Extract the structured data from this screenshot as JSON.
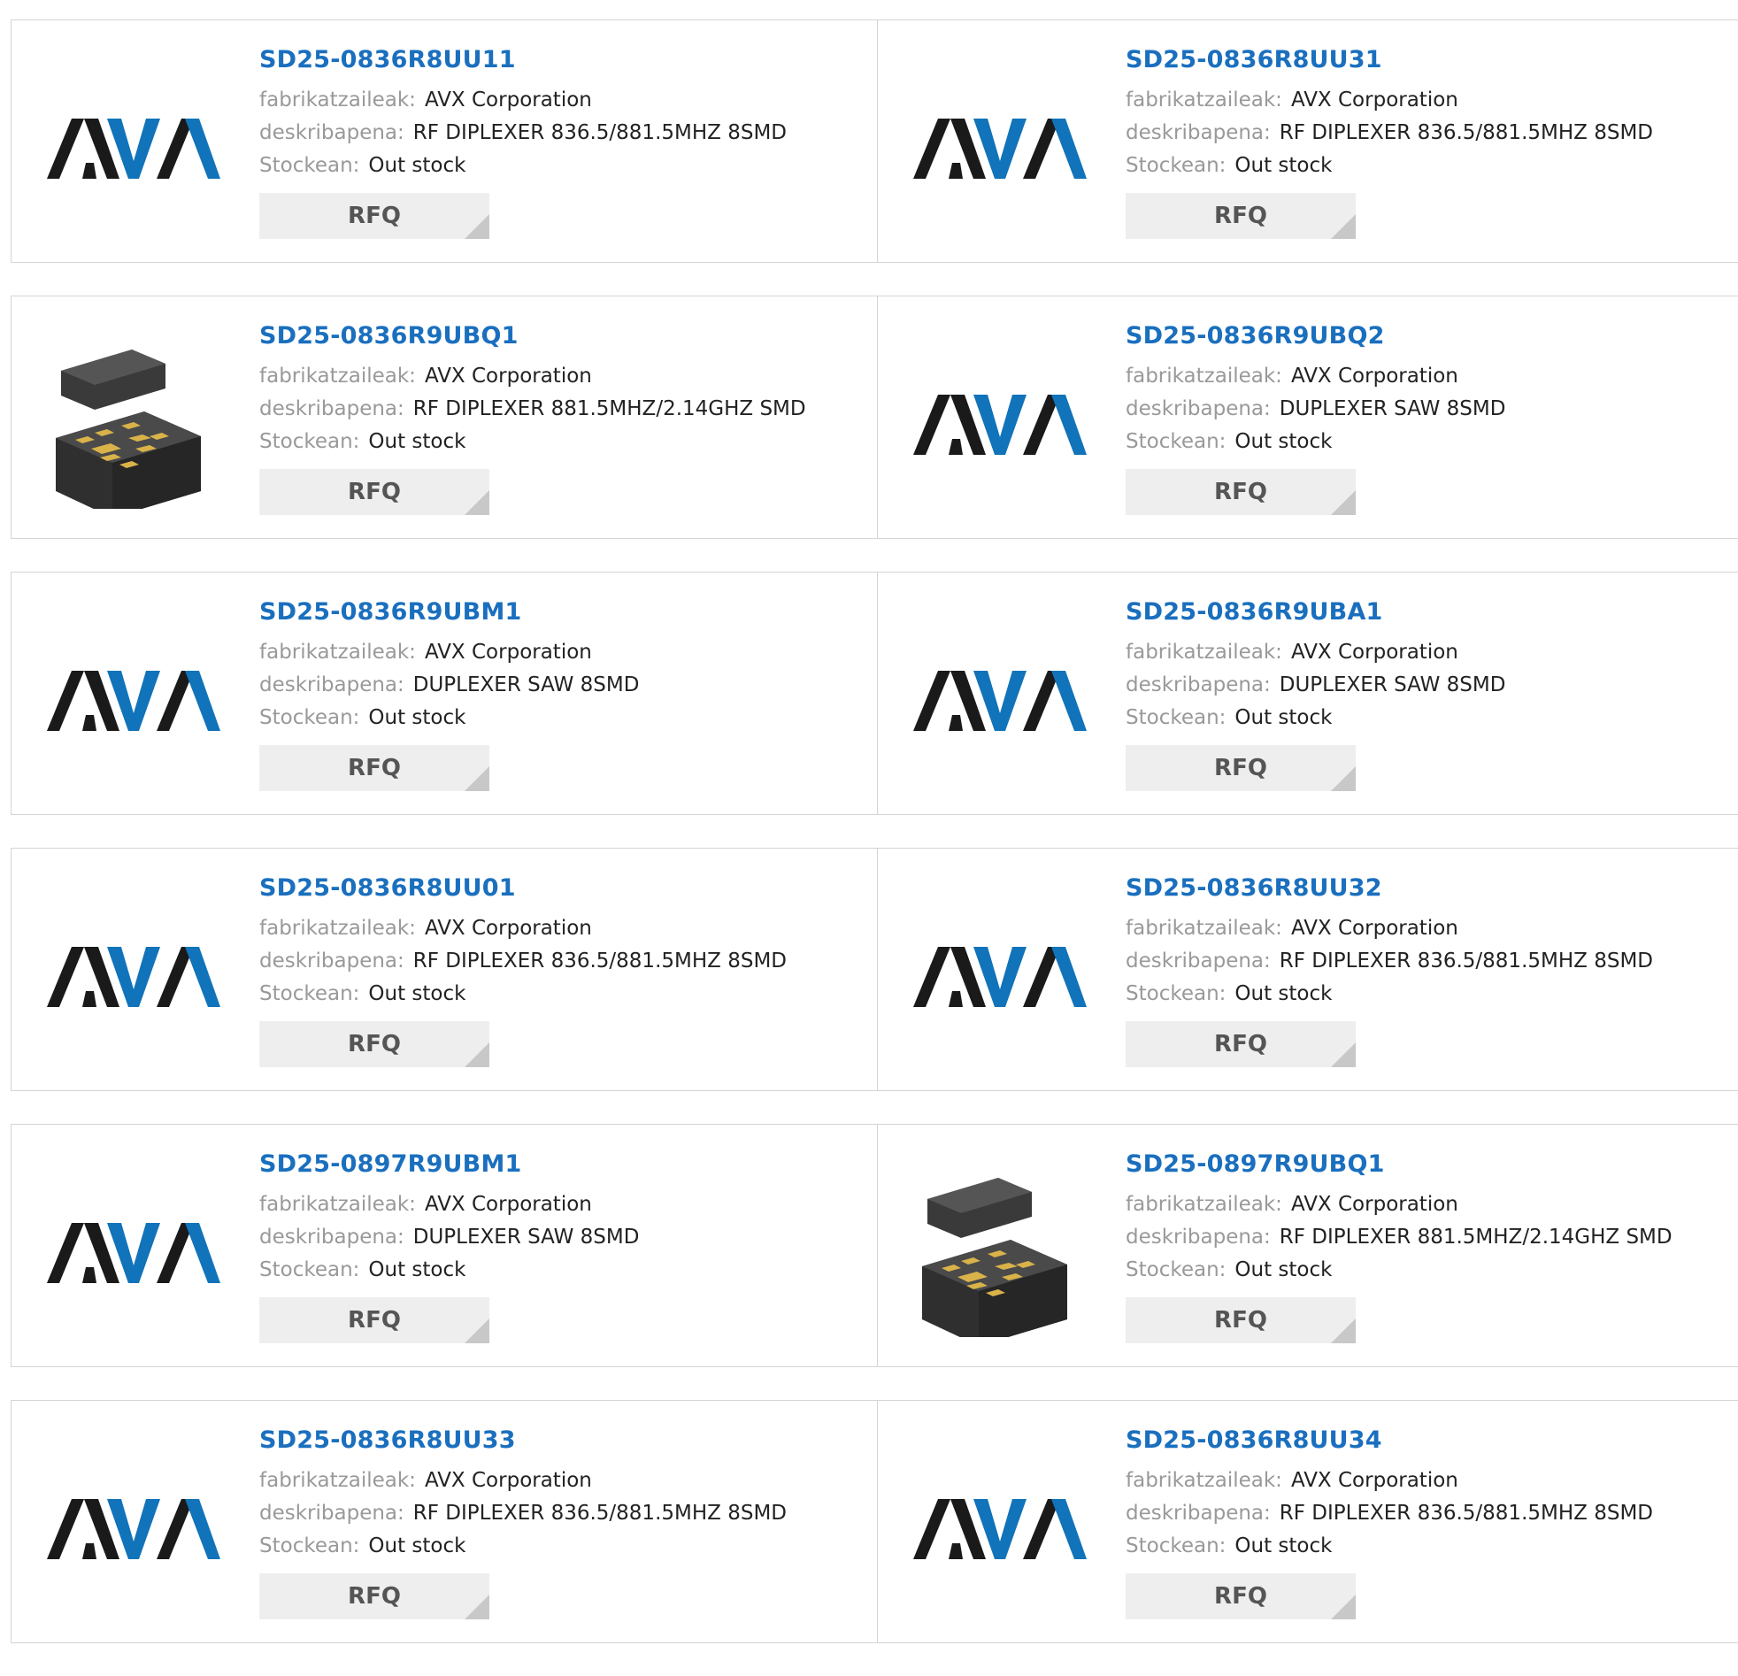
{
  "brand_colors": {
    "title": "#1a6fbe",
    "logo_black": "#1a1a1a",
    "logo_blue": "#1173b9"
  },
  "labels": {
    "manufacturer": "fabrikatzaileak:",
    "description": "deskribapena:",
    "stock": "Stockean:",
    "rfq": "RFQ"
  },
  "products": [
    {
      "part": "SD25-0836R8UU11",
      "manufacturer": "AVX Corporation",
      "description": "RF DIPLEXER 836.5/881.5MHZ 8SMD",
      "stock": "Out stock",
      "image": "avx-logo",
      "logo_text": "AVX"
    },
    {
      "part": "SD25-0836R8UU31",
      "manufacturer": "AVX Corporation",
      "description": "RF DIPLEXER 836.5/881.5MHZ 8SMD",
      "stock": "Out stock",
      "image": "avx-logo",
      "logo_text": "AVX"
    },
    {
      "part": "SD25-0836R9UBQ1",
      "manufacturer": "AVX Corporation",
      "description": "RF DIPLEXER 881.5MHZ/2.14GHZ SMD",
      "stock": "Out stock",
      "image": "chip-package"
    },
    {
      "part": "SD25-0836R9UBQ2",
      "manufacturer": "AVX Corporation",
      "description": "DUPLEXER SAW 8SMD",
      "stock": "Out stock",
      "image": "avx-logo",
      "logo_text": "AVX"
    },
    {
      "part": "SD25-0836R9UBM1",
      "manufacturer": "AVX Corporation",
      "description": "DUPLEXER SAW 8SMD",
      "stock": "Out stock",
      "image": "avx-logo",
      "logo_text": "AVX"
    },
    {
      "part": "SD25-0836R9UBA1",
      "manufacturer": "AVX Corporation",
      "description": "DUPLEXER SAW 8SMD",
      "stock": "Out stock",
      "image": "avx-logo",
      "logo_text": "AVX"
    },
    {
      "part": "SD25-0836R8UU01",
      "manufacturer": "AVX Corporation",
      "description": "RF DIPLEXER 836.5/881.5MHZ 8SMD",
      "stock": "Out stock",
      "image": "avx-logo",
      "logo_text": "AVX"
    },
    {
      "part": "SD25-0836R8UU32",
      "manufacturer": "AVX Corporation",
      "description": "RF DIPLEXER 836.5/881.5MHZ 8SMD",
      "stock": "Out stock",
      "image": "avx-logo",
      "logo_text": "AVX"
    },
    {
      "part": "SD25-0897R9UBM1",
      "manufacturer": "AVX Corporation",
      "description": "DUPLEXER SAW 8SMD",
      "stock": "Out stock",
      "image": "avx-logo",
      "logo_text": "AVX"
    },
    {
      "part": "SD25-0897R9UBQ1",
      "manufacturer": "AVX Corporation",
      "description": "RF DIPLEXER 881.5MHZ/2.14GHZ SMD",
      "stock": "Out stock",
      "image": "chip-package"
    },
    {
      "part": "SD25-0836R8UU33",
      "manufacturer": "AVX Corporation",
      "description": "RF DIPLEXER 836.5/881.5MHZ 8SMD",
      "stock": "Out stock",
      "image": "avx-logo",
      "logo_text": "AVX"
    },
    {
      "part": "SD25-0836R8UU34",
      "manufacturer": "AVX Corporation",
      "description": "RF DIPLEXER 836.5/881.5MHZ 8SMD",
      "stock": "Out stock",
      "image": "avx-logo",
      "logo_text": "AVX"
    }
  ]
}
